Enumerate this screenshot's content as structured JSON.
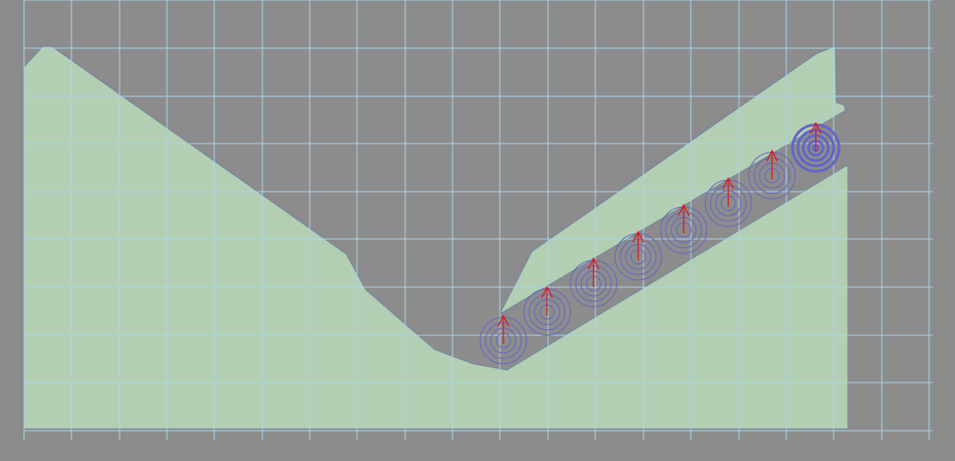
{
  "editor": {
    "colors": {
      "background": "#8c8c8c",
      "grid": "#a9d3ee",
      "terrain_fill": "#b3cfb3",
      "terrain_stroke": "#6f86a6",
      "ring": "#6464c8",
      "arrow": "#e01818"
    },
    "emitters": {
      "count": 8,
      "direction": "up",
      "last_selected": true
    }
  }
}
